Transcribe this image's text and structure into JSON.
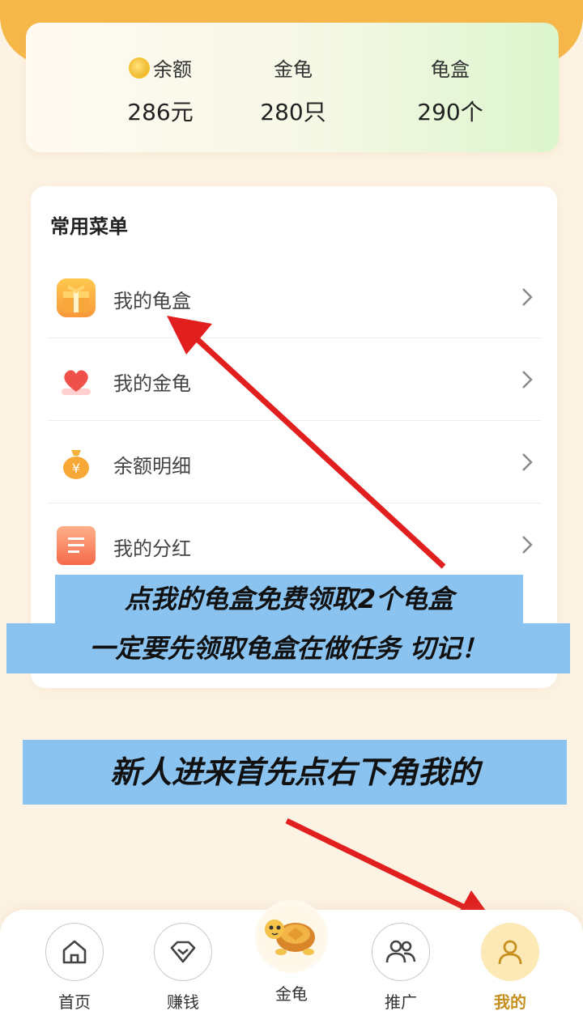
{
  "stats": {
    "balance": {
      "label": "余额",
      "value": "286元"
    },
    "gold_turtle": {
      "label": "金龟",
      "value": "280只"
    },
    "turtle_box": {
      "label": "龟盒",
      "value": "290个"
    }
  },
  "menu": {
    "title": "常用菜单",
    "items": [
      {
        "label": "我的龟盒",
        "icon": "gift-box-icon"
      },
      {
        "label": "我的金龟",
        "icon": "heart-icon"
      },
      {
        "label": "余额明细",
        "icon": "money-bag-icon"
      },
      {
        "label": "我的分红",
        "icon": "document-icon"
      }
    ]
  },
  "annotations": {
    "line1": "点我的龟盒免费领取2个龟盒",
    "line2": "一定要先领取龟盒在做任务 切记！",
    "line3": "新人进来首先点右下角我的"
  },
  "tabs": [
    {
      "label": "首页",
      "icon": "home-icon"
    },
    {
      "label": "赚钱",
      "icon": "diamond-icon"
    },
    {
      "label": "金龟",
      "icon": "turtle-icon"
    },
    {
      "label": "推广",
      "icon": "users-icon"
    },
    {
      "label": "我的",
      "icon": "user-icon",
      "active": true
    }
  ],
  "colors": {
    "accent": "#c68f1e",
    "banner": "#8ac3ef",
    "arrow": "#e11f1f"
  }
}
